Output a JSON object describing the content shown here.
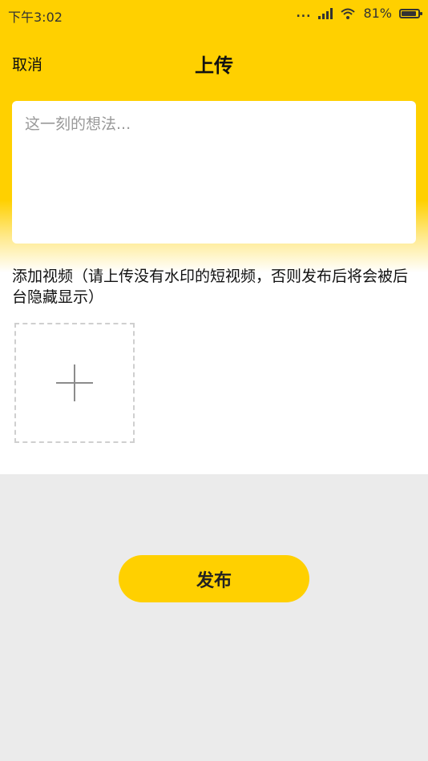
{
  "status_bar": {
    "time": "下午3:02",
    "dots": "...",
    "battery_text": "81%",
    "battery_level": 0.81
  },
  "header": {
    "cancel_label": "取消",
    "title": "上传"
  },
  "composer": {
    "placeholder": "这一刻的想法..."
  },
  "video_section": {
    "label": "添加视频（请上传没有水印的短视频，否则发布后将会被后台隐藏显示）",
    "add_icon": "plus-icon"
  },
  "actions": {
    "publish_label": "发布"
  },
  "colors": {
    "accent": "#ffd000",
    "background": "#ebebeb"
  }
}
